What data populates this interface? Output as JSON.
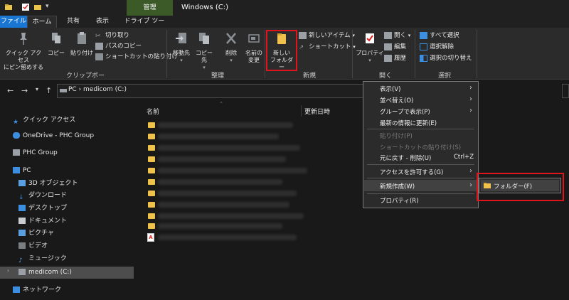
{
  "window": {
    "context_tab": "管理",
    "title": "Windows (C:)"
  },
  "tabs": {
    "file": "ファイル",
    "home": "ホーム",
    "share": "共有",
    "view": "表示",
    "drive_tools": "ドライブ ツール"
  },
  "ribbon": {
    "pin_quick_access": [
      "クイック アクセス",
      "にピン留めする"
    ],
    "copy": "コピー",
    "paste": "貼り付け",
    "cut": "切り取り",
    "copy_path": "パスのコピー",
    "paste_shortcut": "ショートカットの貼り付け",
    "group_clipboard": "クリップボード",
    "move_to": "移動先",
    "copy_to": "コピー先",
    "delete": "削除",
    "rename": [
      "名前の",
      "変更"
    ],
    "group_organize": "整理",
    "new_folder": [
      "新しい",
      "フォルダー"
    ],
    "new_item": "新しいアイテム",
    "shortcut": "ショートカット",
    "group_new": "新規",
    "properties": "プロパティ",
    "open": "開く",
    "edit": "編集",
    "history": "履歴",
    "group_open": "開く",
    "select_all": "すべて選択",
    "select_none": "選択解除",
    "invert_selection": "選択の切り替え",
    "group_select": "選択"
  },
  "address": {
    "path": "PC  ›  medicom (C:)"
  },
  "sidebar": {
    "quick_access": "クイック アクセス",
    "onedrive": "OneDrive - PHC Group",
    "phc_group": "PHC Group",
    "pc": "PC",
    "objects3d": "3D オブジェクト",
    "downloads": "ダウンロード",
    "desktop": "デスクトップ",
    "documents": "ドキュメント",
    "pictures": "ピクチャ",
    "videos": "ビデオ",
    "music": "ミュージック",
    "medicom": "medicom  (C:)",
    "network": "ネットワーク"
  },
  "columns": {
    "name": "名前",
    "modified": "更新日時"
  },
  "context_menu": {
    "view": "表示(V)",
    "sort_by": "並べ替え(O)",
    "group_by": "グループで表示(P)",
    "refresh": "最新の情報に更新(E)",
    "paste": "貼り付け(P)",
    "paste_shortcut": "ショートカットの貼り付け(S)",
    "undo": "元に戻す - 削除(U)",
    "undo_shortcut": "Ctrl+Z",
    "give_access": "アクセスを許可する(G)",
    "new": "新規作成(W)",
    "properties": "プロパティ(R)"
  },
  "submenu": {
    "folder": "フォルダー(F)"
  },
  "colors": {
    "accent": "#1976d2",
    "highlight_box": "#e0141b",
    "folder": "#f0c24b"
  }
}
